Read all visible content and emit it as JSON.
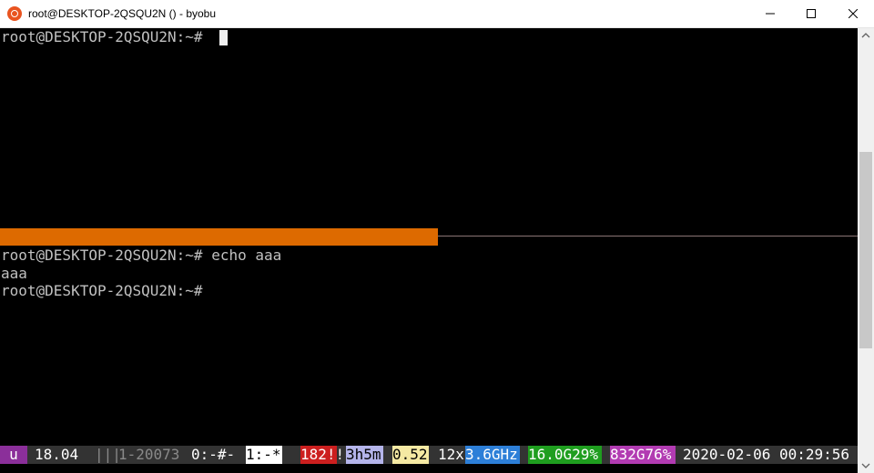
{
  "window": {
    "title": "root@DESKTOP-2QSQU2N () - byobu",
    "app_icon": "ubuntu-icon",
    "buttons": [
      "minimize-icon",
      "maximize-icon",
      "close-icon"
    ]
  },
  "top_pane": {
    "lines": [
      "root@DESKTOP-2QSQU2N:~# "
    ]
  },
  "bottom_pane": {
    "lines": [
      "root@DESKTOP-2QSQU2N:~# echo aaa",
      "aaa",
      "root@DESKTOP-2QSQU2N:~#"
    ]
  },
  "colors": {
    "active_pane_divider": "#dd6a00",
    "terminal_bg": "#000000",
    "terminal_fg": "#c0c0c0"
  },
  "status_bar": {
    "os_badge": "u",
    "release": "18.04",
    "graph": "|||",
    "session": "1-20073",
    "window_0": "0:-#-",
    "window_1": "1:-*",
    "processes": "182!!",
    "uptime": "3h5m",
    "load": "0.52",
    "cpu_count": "12x",
    "cpu_freq": "3.6GHz",
    "memory": "16.0G29%",
    "disk": "832G76%",
    "datetime": "2020-02-06 00:29:56"
  }
}
